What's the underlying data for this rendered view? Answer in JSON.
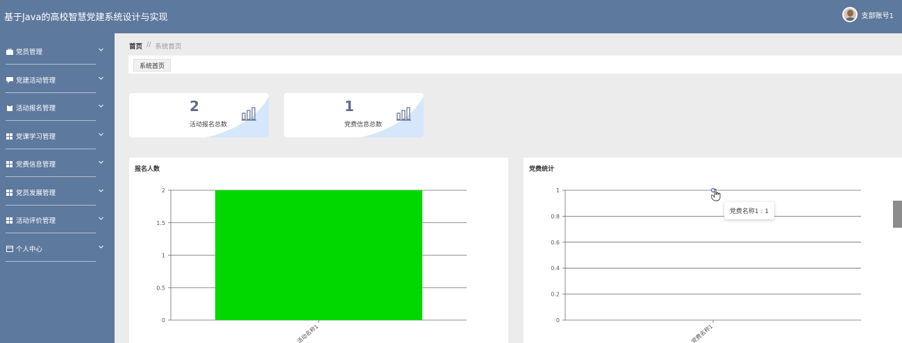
{
  "header": {
    "title": "基于Java的高校智慧党建系统设计与实现",
    "user_name": "支部账号1"
  },
  "sidebar": {
    "items": [
      {
        "label": "党员管理",
        "icon": "briefcase-icon"
      },
      {
        "label": "党建活动管理",
        "icon": "chat-icon"
      },
      {
        "label": "活动报名管理",
        "icon": "clipboard-icon"
      },
      {
        "label": "党课学习管理",
        "icon": "grid-icon"
      },
      {
        "label": "党费信息管理",
        "icon": "grid-icon"
      },
      {
        "label": "党员发展管理",
        "icon": "grid-icon"
      },
      {
        "label": "活动评价管理",
        "icon": "grid-icon"
      },
      {
        "label": "个人中心",
        "icon": "window-icon"
      }
    ]
  },
  "breadcrumb": {
    "home": "首页",
    "separator": "//",
    "current": "系统首页"
  },
  "tabs": [
    {
      "label": "系统首页"
    }
  ],
  "stats": [
    {
      "value": "2",
      "label": "活动报名总数",
      "icon": "bar-chart-icon"
    },
    {
      "value": "1",
      "label": "党费信息总数",
      "icon": "bar-chart-icon"
    }
  ],
  "tooltip": {
    "text": "党费名称1 : 1"
  },
  "colors": {
    "header_bg": "#5e799e",
    "sidebar_bg": "#5e799e",
    "bar_green": "#00d800",
    "line_series": "#5b6fbf",
    "card_wave": "#d6e6fb"
  },
  "chart_data": [
    {
      "type": "bar",
      "title": "报名人数",
      "categories": [
        "活动名称1"
      ],
      "values": [
        2
      ],
      "ylim": [
        0,
        2
      ],
      "yticks": [
        "0",
        "0.5",
        "1",
        "1.5",
        "2"
      ],
      "grid": true
    },
    {
      "type": "line",
      "title": "党费统计",
      "categories": [
        "党费名称1"
      ],
      "values": [
        1
      ],
      "ylim": [
        0,
        1
      ],
      "yticks": [
        "0",
        "0.2",
        "0.4",
        "0.6",
        "0.8",
        "1"
      ],
      "grid": true
    }
  ]
}
